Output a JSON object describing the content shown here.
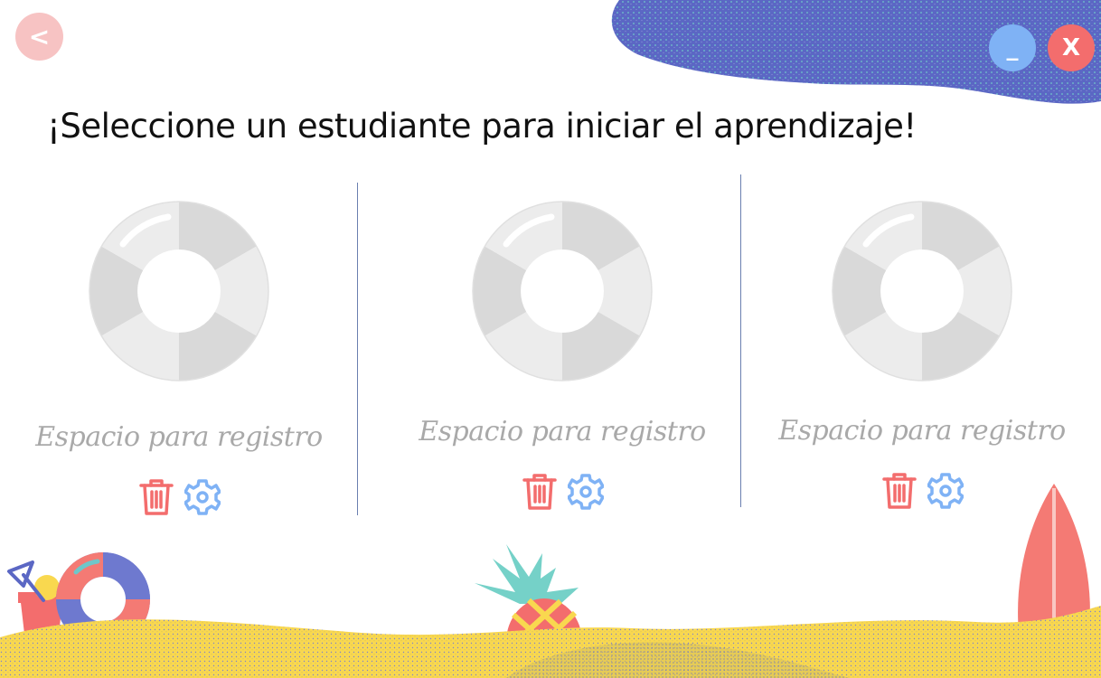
{
  "window": {
    "back_label": "<",
    "minimize_label": "_",
    "close_label": "X"
  },
  "page": {
    "title": "¡Seleccione un estudiante para iniciar el aprendizaje!"
  },
  "students": [
    {
      "label": "Espacio para registro",
      "delete_icon": "trash-icon",
      "settings_icon": "gear-icon"
    },
    {
      "label": "Espacio para registro",
      "delete_icon": "trash-icon",
      "settings_icon": "gear-icon"
    },
    {
      "label": "Espacio para registro",
      "delete_icon": "trash-icon",
      "settings_icon": "gear-icon"
    }
  ],
  "colors": {
    "blob_blue": "#5b67c4",
    "minimize": "#7fb2f5",
    "close": "#f36d6d",
    "back": "#f7c3c3",
    "trash": "#f36d6d",
    "gear": "#7fb2f5",
    "sand": "#f9d84f",
    "ring_gray": "#d9d9d9",
    "ring_light": "#ececec"
  }
}
